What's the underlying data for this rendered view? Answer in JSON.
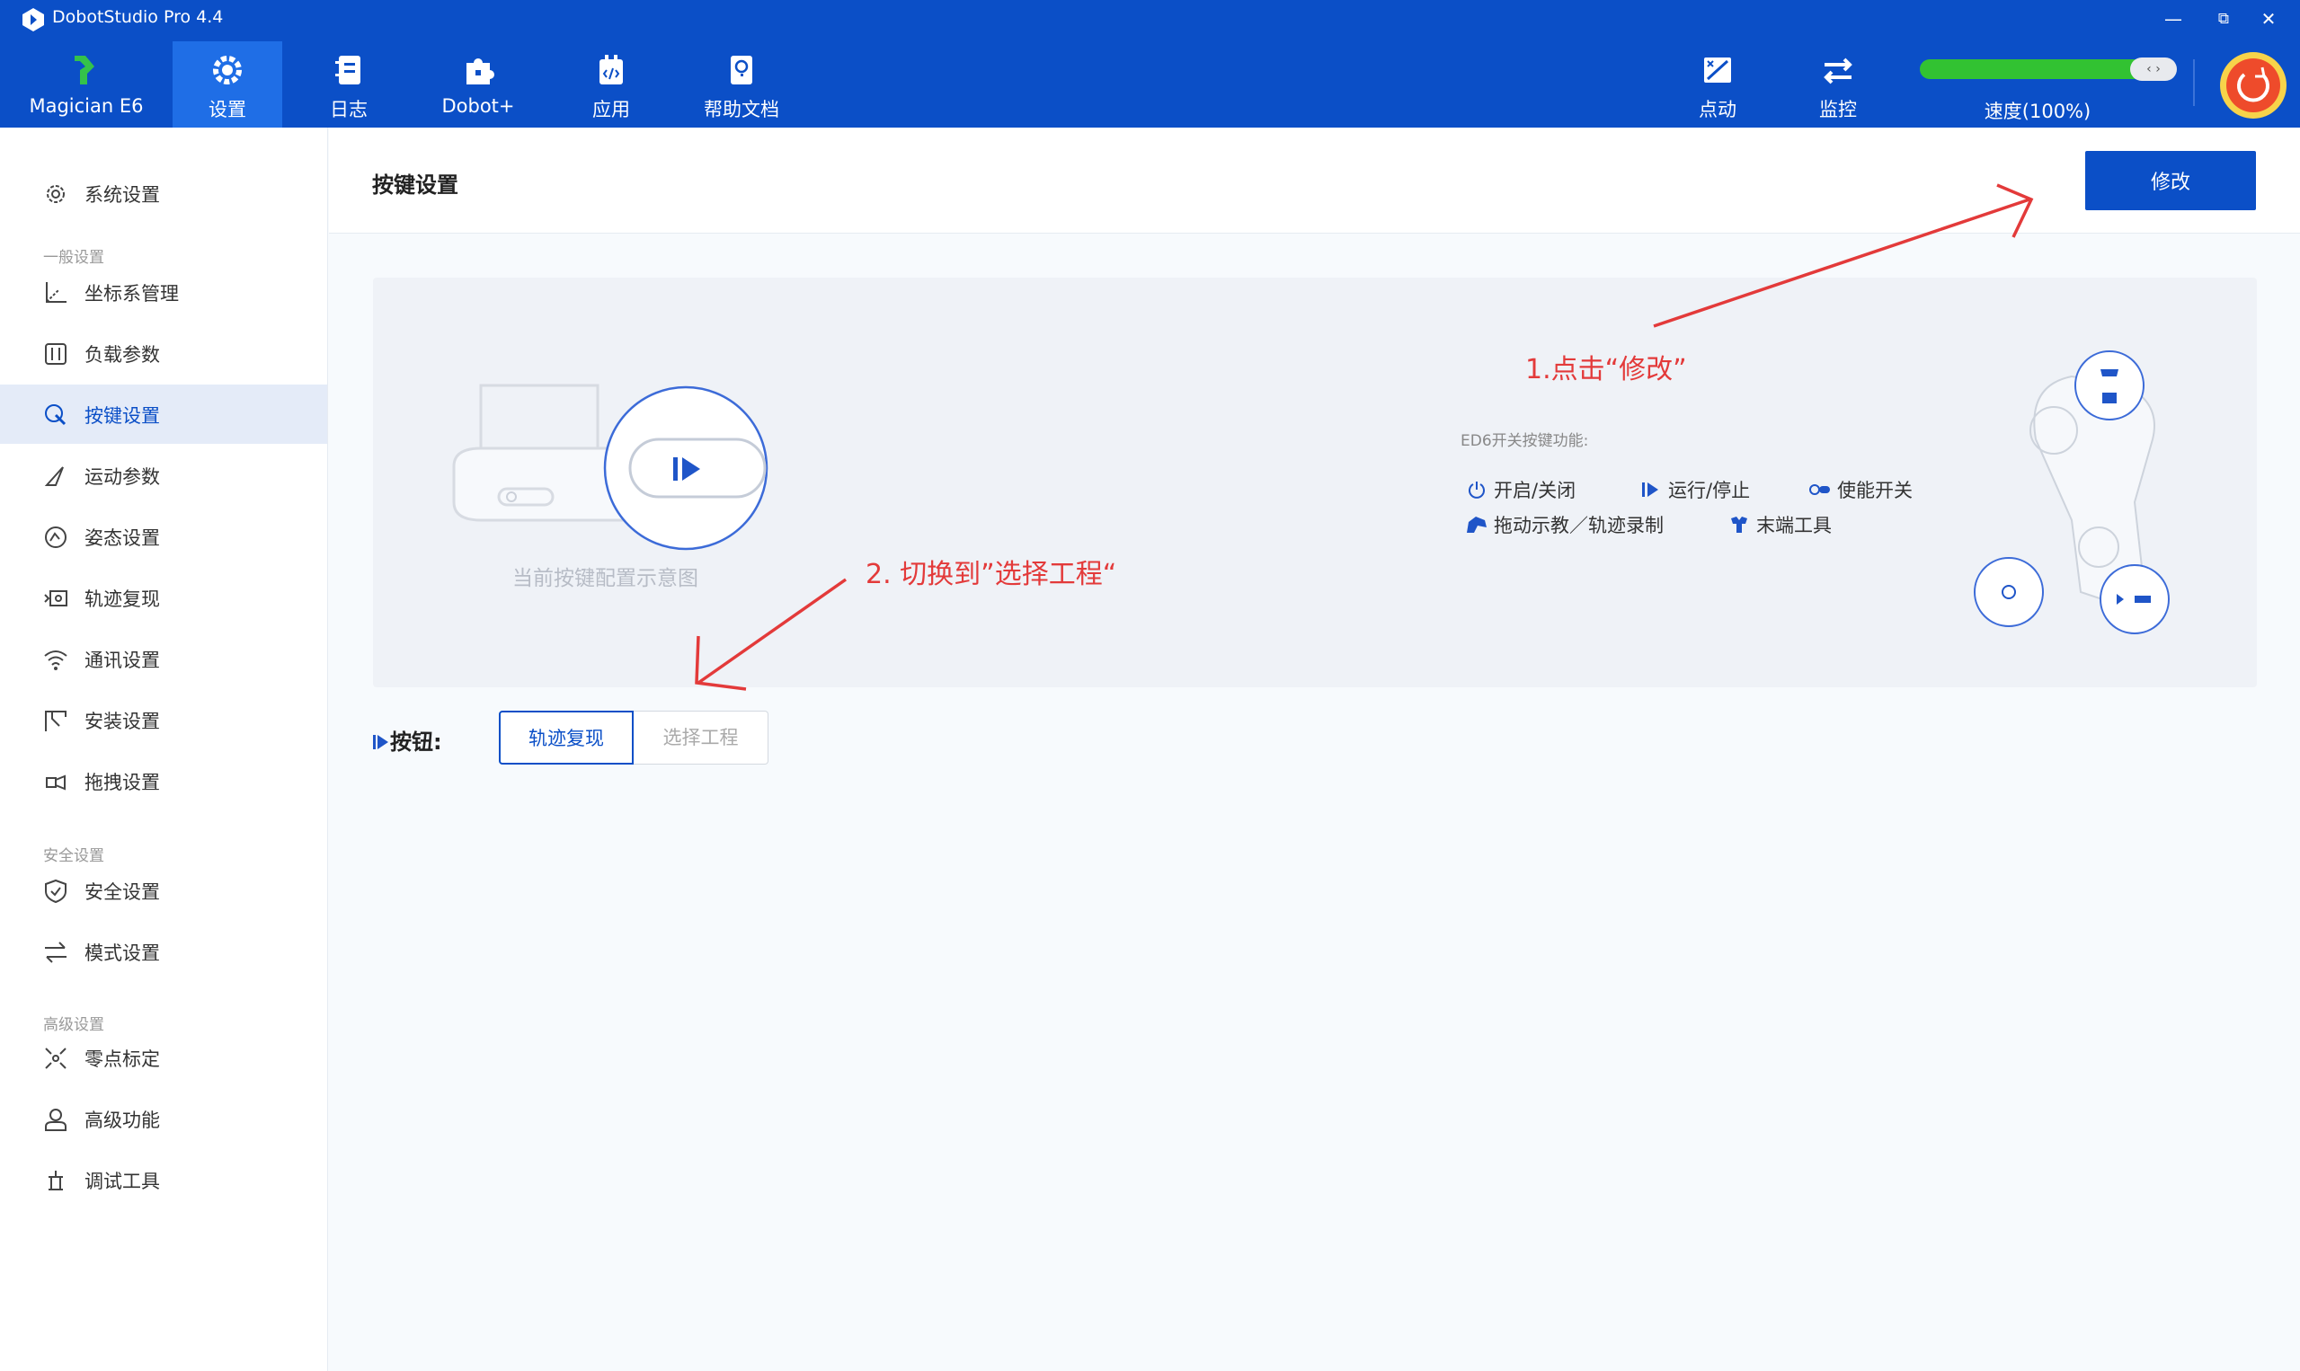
{
  "app": {
    "title": "DobotStudio Pro 4.4"
  },
  "window_controls": {
    "minimize": "—",
    "restore": "⧉",
    "close": "✕"
  },
  "nav": {
    "items": [
      {
        "label": "Magician E6",
        "icon": "robot-arm-logo-icon"
      },
      {
        "label": "设置",
        "icon": "gear-icon",
        "active": true
      },
      {
        "label": "日志",
        "icon": "notebook-icon"
      },
      {
        "label": "Dobot+",
        "icon": "puzzle-icon"
      },
      {
        "label": "应用",
        "icon": "app-code-icon"
      },
      {
        "label": "帮助文档",
        "icon": "help-doc-icon"
      }
    ],
    "right_items": [
      {
        "label": "点动",
        "icon": "jog-icon"
      },
      {
        "label": "监控",
        "icon": "monitor-arrows-icon"
      }
    ],
    "speed_label": "速度(100%)",
    "speed_value": 1.0,
    "speed_knob": "‹ ›"
  },
  "sidebar": {
    "items": [
      {
        "label": "系统设置",
        "icon": "gear-icon"
      },
      {
        "section": "一般设置"
      },
      {
        "label": "坐标系管理",
        "icon": "axes-icon"
      },
      {
        "label": "负载参数",
        "icon": "sliders-icon"
      },
      {
        "label": "按键设置",
        "icon": "button-settings-icon",
        "active": true
      },
      {
        "label": "运动参数",
        "icon": "motion-icon"
      },
      {
        "label": "姿态设置",
        "icon": "posture-icon"
      },
      {
        "label": "轨迹复现",
        "icon": "trajectory-icon"
      },
      {
        "label": "通讯设置",
        "icon": "wifi-icon"
      },
      {
        "label": "安装设置",
        "icon": "install-icon"
      },
      {
        "label": "拖拽设置",
        "icon": "drag-icon"
      },
      {
        "section": "安全设置"
      },
      {
        "label": "安全设置",
        "icon": "shield-icon"
      },
      {
        "label": "模式设置",
        "icon": "swap-icon"
      },
      {
        "section": "高级设置"
      },
      {
        "label": "零点标定",
        "icon": "calibrate-icon"
      },
      {
        "label": "高级功能",
        "icon": "user-icon"
      },
      {
        "label": "调试工具",
        "icon": "debug-tool-icon"
      }
    ]
  },
  "main": {
    "title": "按键设置",
    "edit_button": "修改",
    "diagram_caption": "当前按键配置示意图",
    "functions_title": "ED6开关按键功能:",
    "functions": [
      {
        "label": "开启/关闭",
        "icon": "power-icon"
      },
      {
        "label": "运行/停止",
        "icon": "play-pause-icon"
      },
      {
        "label": "使能开关",
        "icon": "enable-switch-icon"
      },
      {
        "label": "拖动示教／轨迹录制",
        "icon": "drag-teach-icon"
      },
      {
        "label": "末端工具",
        "icon": "end-tool-icon"
      }
    ],
    "button_row_label": "按钮:",
    "segments": [
      "轨迹复现",
      "选择工程"
    ],
    "selected_segment": "轨迹复现"
  },
  "annotations": {
    "step1": "1.点击“修改”",
    "step2": "2. 切换到”选择工程“"
  },
  "colors": {
    "header_bg": "#0b4fc7",
    "accent": "#0b4fc7",
    "speed_bar": "#32c232",
    "annotation": "#e33a3a"
  }
}
